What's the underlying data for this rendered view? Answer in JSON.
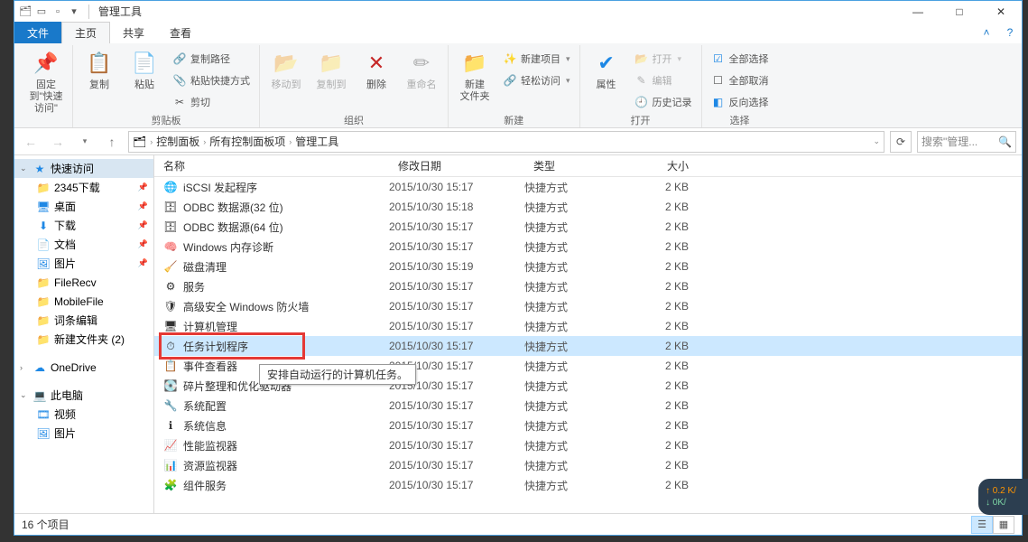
{
  "window": {
    "title": "管理工具"
  },
  "wincontrols": {
    "min": "—",
    "max": "□",
    "close": "✕"
  },
  "ribbontabs": {
    "file": "文件",
    "home": "主页",
    "share": "共享",
    "view": "查看"
  },
  "ribbon": {
    "pin_group": {
      "pin": "固定到\"快速访问\""
    },
    "clipboard": {
      "copy": "复制",
      "paste": "粘贴",
      "copypath": "复制路径",
      "pasteshortcut": "粘贴快捷方式",
      "cut": "剪切",
      "name": "剪贴板"
    },
    "organize": {
      "moveto": "移动到",
      "copyto": "复制到",
      "delete": "删除",
      "rename": "重命名",
      "name": "组织"
    },
    "new": {
      "newfolder": "新建\n文件夹",
      "newitem": "新建项目",
      "easyaccess": "轻松访问",
      "name": "新建"
    },
    "open": {
      "properties": "属性",
      "open": "打开",
      "edit": "编辑",
      "history": "历史记录",
      "name": "打开"
    },
    "select": {
      "selectall": "全部选择",
      "selectnone": "全部取消",
      "invert": "反向选择",
      "name": "选择"
    }
  },
  "breadcrumb": [
    "控制面板",
    "所有控制面板项",
    "管理工具"
  ],
  "search_placeholder": "搜索\"管理...",
  "columns": {
    "name": "名称",
    "date": "修改日期",
    "type": "类型",
    "size": "大小"
  },
  "sidebar": {
    "quickaccess": "快速访问",
    "items": [
      {
        "label": "2345下载",
        "icon": "📁",
        "pin": true
      },
      {
        "label": "桌面",
        "icon": "🖥",
        "pin": true,
        "color": "#1e88e5"
      },
      {
        "label": "下载",
        "icon": "⬇",
        "pin": true,
        "color": "#1e88e5"
      },
      {
        "label": "文档",
        "icon": "📄",
        "pin": true,
        "color": "#6aa84f"
      },
      {
        "label": "图片",
        "icon": "🖼",
        "pin": true,
        "color": "#1e88e5"
      },
      {
        "label": "FileRecv",
        "icon": "📁"
      },
      {
        "label": "MobileFile",
        "icon": "📁"
      },
      {
        "label": "词条编辑",
        "icon": "📁"
      },
      {
        "label": "新建文件夹 (2)",
        "icon": "📁"
      }
    ],
    "onedrive": "OneDrive",
    "thispc": "此电脑",
    "pc_items": [
      {
        "label": "视频",
        "icon": "🎞"
      },
      {
        "label": "图片",
        "icon": "🖼"
      }
    ]
  },
  "files": [
    {
      "name": "iSCSI 发起程序",
      "date": "2015/10/30 15:17",
      "type": "快捷方式",
      "size": "2 KB",
      "icon": "🌐"
    },
    {
      "name": "ODBC 数据源(32 位)",
      "date": "2015/10/30 15:18",
      "type": "快捷方式",
      "size": "2 KB",
      "icon": "🗄"
    },
    {
      "name": "ODBC 数据源(64 位)",
      "date": "2015/10/30 15:17",
      "type": "快捷方式",
      "size": "2 KB",
      "icon": "🗄"
    },
    {
      "name": "Windows 内存诊断",
      "date": "2015/10/30 15:17",
      "type": "快捷方式",
      "size": "2 KB",
      "icon": "🧠"
    },
    {
      "name": "磁盘清理",
      "date": "2015/10/30 15:19",
      "type": "快捷方式",
      "size": "2 KB",
      "icon": "🧹"
    },
    {
      "name": "服务",
      "date": "2015/10/30 15:17",
      "type": "快捷方式",
      "size": "2 KB",
      "icon": "⚙"
    },
    {
      "name": "高级安全 Windows 防火墙",
      "date": "2015/10/30 15:17",
      "type": "快捷方式",
      "size": "2 KB",
      "icon": "🛡"
    },
    {
      "name": "计算机管理",
      "date": "2015/10/30 15:17",
      "type": "快捷方式",
      "size": "2 KB",
      "icon": "🖥"
    },
    {
      "name": "任务计划程序",
      "date": "2015/10/30 15:17",
      "type": "快捷方式",
      "size": "2 KB",
      "icon": "⏱",
      "selected": true
    },
    {
      "name": "事件查看器",
      "date": "2015/10/30 15:17",
      "type": "快捷方式",
      "size": "2 KB",
      "icon": "📋"
    },
    {
      "name": "碎片整理和优化驱动器",
      "date": "2015/10/30 15:17",
      "type": "快捷方式",
      "size": "2 KB",
      "icon": "💽"
    },
    {
      "name": "系统配置",
      "date": "2015/10/30 15:17",
      "type": "快捷方式",
      "size": "2 KB",
      "icon": "🔧"
    },
    {
      "name": "系统信息",
      "date": "2015/10/30 15:17",
      "type": "快捷方式",
      "size": "2 KB",
      "icon": "ℹ"
    },
    {
      "name": "性能监视器",
      "date": "2015/10/30 15:17",
      "type": "快捷方式",
      "size": "2 KB",
      "icon": "📈"
    },
    {
      "name": "资源监视器",
      "date": "2015/10/30 15:17",
      "type": "快捷方式",
      "size": "2 KB",
      "icon": "📊"
    },
    {
      "name": "组件服务",
      "date": "2015/10/30 15:17",
      "type": "快捷方式",
      "size": "2 KB",
      "icon": "🧩"
    }
  ],
  "tooltip": "安排自动运行的计算机任务。",
  "status": "16 个项目",
  "netoverlay": {
    "up": "↑ 0.2 K/",
    "down": "↓ 0K/"
  }
}
